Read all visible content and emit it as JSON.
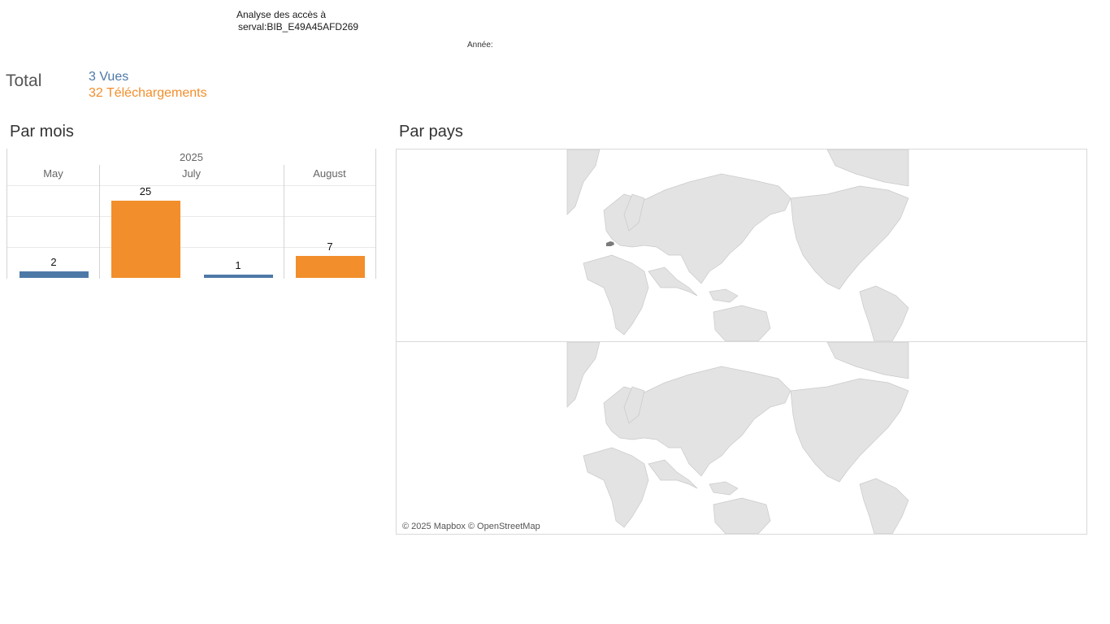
{
  "header": {
    "title_line1": "Analyse des accès à",
    "title_line2": "serval:BIB_E49A45AFD269",
    "year_filter_label": "Année:"
  },
  "totals": {
    "label": "Total",
    "vues": "3 Vues",
    "telechargements": "32 Téléchargements"
  },
  "sections": {
    "par_mois": "Par mois",
    "par_pays": "Par pays"
  },
  "colors": {
    "vues": "#4e79a7",
    "telechargements": "#f28e2b",
    "land": "#e3e3e3",
    "highlight_country": "#7a7a7a"
  },
  "chart_data": {
    "type": "bar",
    "year_label": "2025",
    "months": [
      "May",
      "July",
      "August"
    ],
    "series": [
      {
        "name": "Vues",
        "values": [
          2,
          1,
          null
        ]
      },
      {
        "name": "Téléchargements",
        "values": [
          null,
          25,
          7
        ]
      }
    ],
    "ylim": [
      0,
      30
    ],
    "grid": true
  },
  "map": {
    "attribution": "© 2025 Mapbox © OpenStreetMap",
    "highlighted_country": "Switzerland"
  }
}
